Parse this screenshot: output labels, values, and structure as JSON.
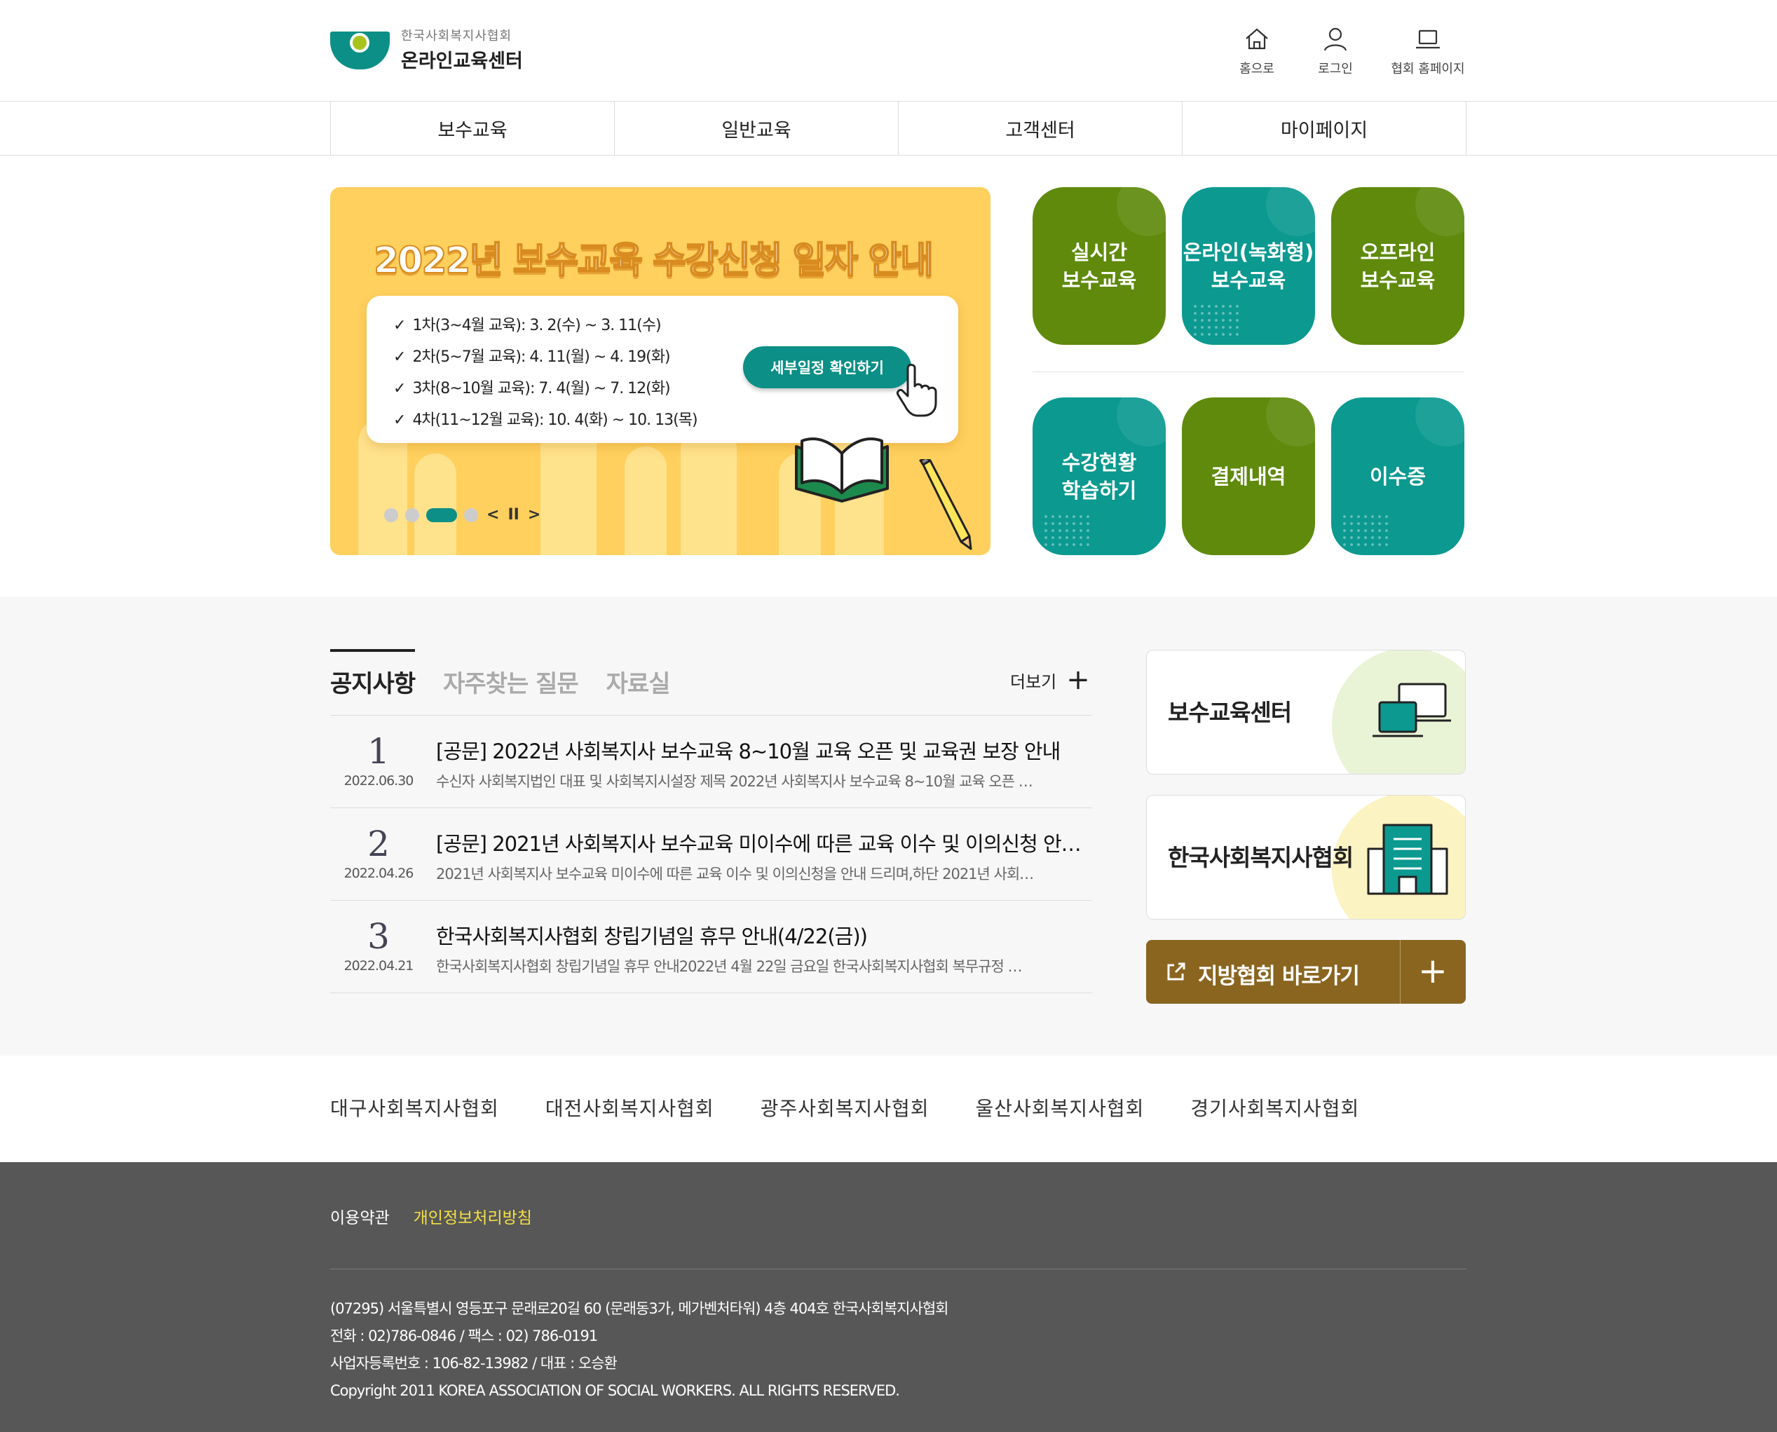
{
  "header": {
    "logo_sub": "한국사회복지사협회",
    "logo_main": "온라인교육센터",
    "util": [
      {
        "label": "홈으로",
        "icon": "home-icon"
      },
      {
        "label": "로그인",
        "icon": "user-icon"
      },
      {
        "label": "협회 홈페이지",
        "icon": "laptop-icon"
      }
    ]
  },
  "gnb": [
    "보수교육",
    "일반교육",
    "고객센터",
    "마이페이지"
  ],
  "banner": {
    "title": "2022년 보수교육 수강신청 일자 안내",
    "schedule": [
      "1차(3~4월 교육): 3. 2(수) ~ 3. 11(수)",
      "2차(5~7월 교육): 4. 11(월) ~ 4. 19(화)",
      "3차(8~10월 교육): 7. 4(월) ~ 7. 12(화)",
      "4차(11~12월 교육): 10. 4(화) ~ 10. 13(목)"
    ],
    "button": "세부일정 확인하기",
    "slides_total": 4,
    "slide_active": 3,
    "prev": "<",
    "pause": "II",
    "next": ">"
  },
  "quick_tiles": [
    {
      "label": "실시간\n보수교육",
      "color": "#5f8a0c"
    },
    {
      "label": "온라인(녹화형)\n보수교육",
      "color": "#0b9990"
    },
    {
      "label": "오프라인\n보수교육",
      "color": "#5f8a0c"
    },
    {
      "label": "수강현황\n학습하기",
      "color": "#0b9990"
    },
    {
      "label": "결제내역",
      "color": "#5f8a0c"
    },
    {
      "label": "이수증",
      "color": "#0b9990"
    }
  ],
  "board": {
    "tabs": [
      "공지사항",
      "자주찾는 질문",
      "자료실"
    ],
    "active_tab": 0,
    "more": "더보기",
    "posts": [
      {
        "num": "1",
        "date": "2022.06.30",
        "title": "[공문] 2022년 사회복지사 보수교육 8~10월 교육 오픈 및 교육권 보장 안내",
        "summary": "수신자 사회복지법인 대표 및 사회복지시설장 제목 2022년 사회복지사 보수교육 8~10월 교육 오픈 …"
      },
      {
        "num": "2",
        "date": "2022.04.26",
        "title": "[공문] 2021년 사회복지사 보수교육 미이수에 따른 교육 이수 및 이의신청 안…",
        "summary": "2021년 사회복지사 보수교육 미이수에 따른 교육 이수 및 이의신청을 안내 드리며,하단 2021년 사회…"
      },
      {
        "num": "3",
        "date": "2022.04.21",
        "title": "한국사회복지사협회 창립기념일 휴무 안내(4/22(금))",
        "summary": " 한국사회복지사협회 창립기념일 휴무 안내2022년 4월 22일 금요일 한국사회복지사협회 복무규정 …"
      }
    ]
  },
  "side": {
    "card1": "보수교육센터",
    "card2": "한국사회복지사협회",
    "region_button": "지방협회 바로가기"
  },
  "associations": [
    "대구사회복지사협회",
    "대전사회복지사협회",
    "광주사회복지사협회",
    "울산사회복지사협회",
    "경기사회복지사협회"
  ],
  "footer": {
    "links": [
      "이용약관",
      "개인정보처리방침"
    ],
    "address": "(07295) 서울특별시 영등포구 문래로20길 60 (문래동3가, 메가벤처타워) 4층 404호 한국사회복지사협회",
    "phone": "전화 : 02)786-0846 / 팩스 : 02) 786-0191",
    "biz": "사업자등록번호 : 106-82-13982 / 대표 : 오승환",
    "copyright": "Copyright 2011 KOREA ASSOCIATION OF SOCIAL WORKERS. ALL RIGHTS RESERVED."
  },
  "colors": {
    "teal": "#0b9990",
    "green": "#5f8a0c",
    "brown": "#8a6520",
    "banner_yellow": "#ffd05e",
    "footer_bg": "#575757",
    "footer_highlight": "#f4e044"
  }
}
